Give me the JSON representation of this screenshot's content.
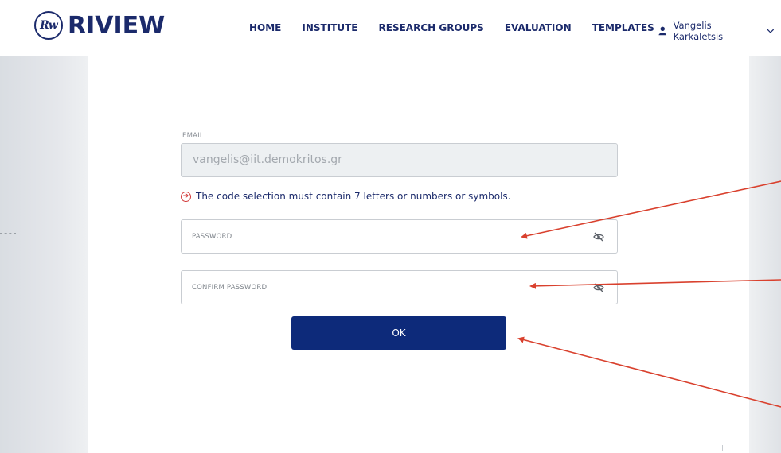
{
  "brand": {
    "logo_mark": "Rw",
    "logo_text": "RIVIEW"
  },
  "nav": {
    "items": [
      {
        "label": "HOME"
      },
      {
        "label": "INSTITUTE"
      },
      {
        "label": "RESEARCH GROUPS"
      },
      {
        "label": "EVALUATION"
      },
      {
        "label": "TEMPLATES"
      }
    ]
  },
  "user": {
    "name": "Vangelis Karkaletsis",
    "icon": "user-icon"
  },
  "form": {
    "email_label": "EMAIL",
    "email_value": "vangelis@iit.demokritos.gr",
    "error_message": "The code selection must contain 7 letters or numbers or symbols.",
    "password_placeholder": "PASSWORD",
    "confirm_placeholder": "CONFIRM PASSWORD",
    "ok_label": "OK"
  },
  "colors": {
    "brand": "#1b2a6b",
    "button": "#0d2a7a",
    "error": "#d33b3b",
    "annotation": "#d9412e"
  }
}
